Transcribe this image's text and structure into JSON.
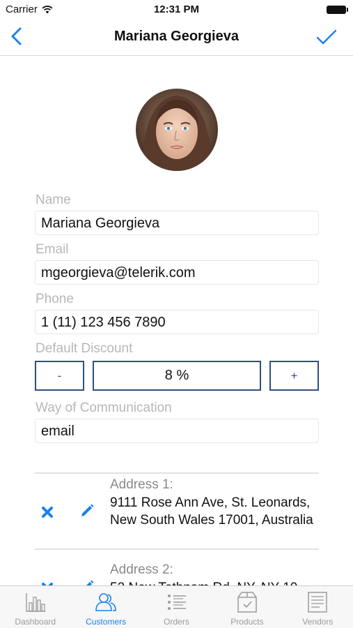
{
  "status_bar": {
    "carrier": "Carrier",
    "time": "12:31 PM"
  },
  "nav": {
    "title": "Mariana Georgieva"
  },
  "form": {
    "name_label": "Name",
    "name_value": "Mariana Georgieva",
    "email_label": "Email",
    "email_value": "mgeorgieva@telerik.com",
    "phone_label": "Phone",
    "phone_value": "1 (11) 123 456 7890",
    "discount_label": "Default Discount",
    "discount_minus": "-",
    "discount_value": "8 %",
    "discount_plus": "+",
    "communication_label": "Way of Communication",
    "communication_value": "email"
  },
  "addresses": [
    {
      "label": "Address 1:",
      "text": "9111 Rose Ann Ave, St. Leonards, New South Wales 17001, Australia"
    },
    {
      "label": "Address 2:",
      "text": "52 New Tothnam Rd, NY, NY 10"
    }
  ],
  "tabs": [
    {
      "label": "Dashboard",
      "icon": "bar-chart-icon",
      "active": false
    },
    {
      "label": "Customers",
      "icon": "people-icon",
      "active": true
    },
    {
      "label": "Orders",
      "icon": "list-icon",
      "active": false
    },
    {
      "label": "Products",
      "icon": "box-icon",
      "active": false
    },
    {
      "label": "Vendors",
      "icon": "receipt-icon",
      "active": false
    }
  ],
  "colors": {
    "accent": "#1a7ff2",
    "stepper_border": "#2f4f7a",
    "label_gray": "#b7b7b7"
  }
}
